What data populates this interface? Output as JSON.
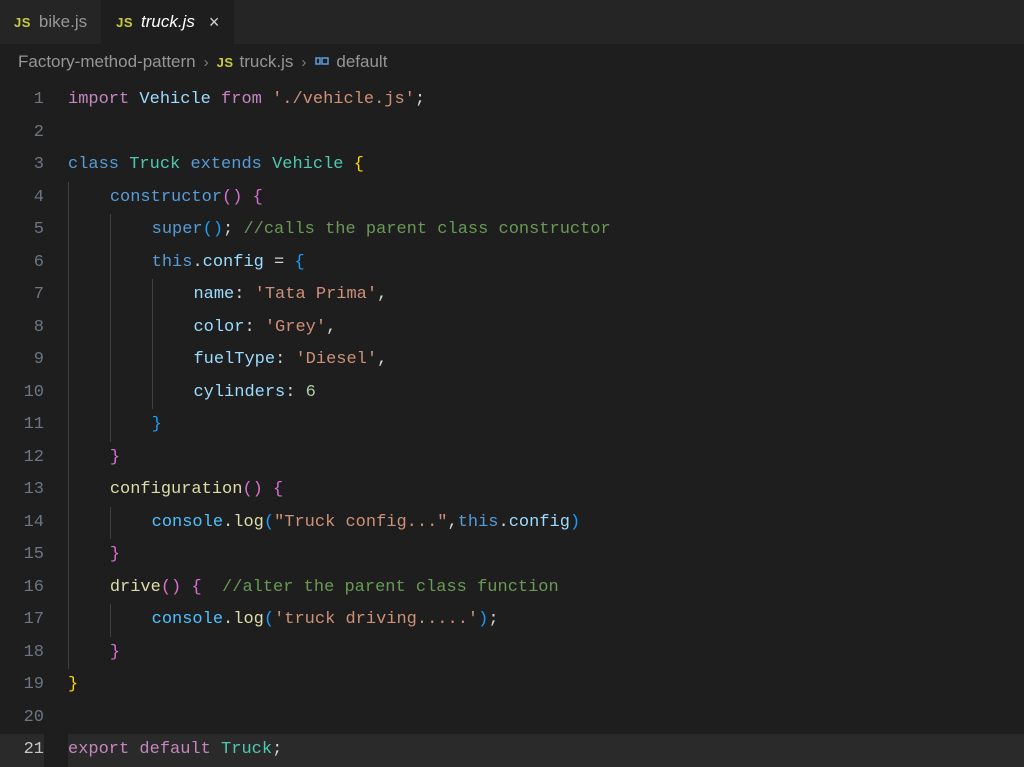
{
  "tabs": [
    {
      "icon": "JS",
      "label": "bike.js",
      "active": false
    },
    {
      "icon": "JS",
      "label": "truck.js",
      "active": true
    }
  ],
  "breadcrumbs": {
    "folder": "Factory-method-pattern",
    "file_icon": "JS",
    "file": "truck.js",
    "symbol": "default"
  },
  "code": {
    "lines": [
      {
        "n": 1
      },
      {
        "n": 2
      },
      {
        "n": 3
      },
      {
        "n": 4
      },
      {
        "n": 5
      },
      {
        "n": 6
      },
      {
        "n": 7
      },
      {
        "n": 8
      },
      {
        "n": 9
      },
      {
        "n": 10
      },
      {
        "n": 11
      },
      {
        "n": 12
      },
      {
        "n": 13
      },
      {
        "n": 14
      },
      {
        "n": 15
      },
      {
        "n": 16
      },
      {
        "n": 17
      },
      {
        "n": 18
      },
      {
        "n": 19
      },
      {
        "n": 20
      },
      {
        "n": 21
      }
    ],
    "tokens": {
      "l1": {
        "import": "import",
        "vehicle": "Vehicle",
        "from": "from",
        "path": "'./vehicle.js'",
        "semi": ";"
      },
      "l3": {
        "class": "class",
        "truck": "Truck",
        "extends": "extends",
        "vehicle": "Vehicle",
        "brace": "{"
      },
      "l4": {
        "constructor": "constructor",
        "parens": "()",
        "brace": "{"
      },
      "l5": {
        "super": "super",
        "parens": "()",
        "semi": ";",
        "comment": "//calls the parent class constructor"
      },
      "l6": {
        "this": "this",
        "dot": ".",
        "config": "config",
        "eq": " = ",
        "brace": "{"
      },
      "l7": {
        "key": "name",
        "colon": ":",
        "val": "'Tata Prima'",
        "comma": ","
      },
      "l8": {
        "key": "color",
        "colon": ":",
        "val": "'Grey'",
        "comma": ","
      },
      "l9": {
        "key": "fuelType",
        "colon": ":",
        "val": "'Diesel'",
        "comma": ","
      },
      "l10": {
        "key": "cylinders",
        "colon": ":",
        "val": "6"
      },
      "l11": {
        "brace": "}"
      },
      "l12": {
        "brace": "}"
      },
      "l13": {
        "fn": "configuration",
        "parens": "()",
        "brace": "{"
      },
      "l14": {
        "console": "console",
        "dot": ".",
        "log": "log",
        "open": "(",
        "str": "\"Truck config...\"",
        "comma": ",",
        "this": "this",
        "dot2": ".",
        "config": "config",
        "close": ")"
      },
      "l15": {
        "brace": "}"
      },
      "l16": {
        "fn": "drive",
        "parens": "()",
        "brace": "{",
        "comment": "//alter the parent class function"
      },
      "l17": {
        "console": "console",
        "dot": ".",
        "log": "log",
        "open": "(",
        "str": "'truck driving.....'",
        "close": ")",
        "semi": ";"
      },
      "l18": {
        "brace": "}"
      },
      "l19": {
        "brace": "}"
      },
      "l21": {
        "export": "export",
        "default": "default",
        "truck": "Truck",
        "semi": ";"
      }
    }
  }
}
